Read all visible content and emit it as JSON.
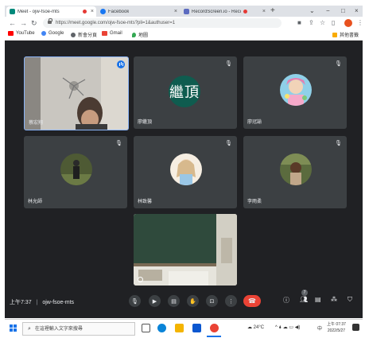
{
  "browser": {
    "tabs": [
      {
        "title": "Meet - ojw-fsoe-mts",
        "active": true,
        "recording": true
      },
      {
        "title": "Facebook",
        "active": false,
        "recording": false
      },
      {
        "title": "RecordScreen.io - Record",
        "active": false,
        "recording": true
      }
    ],
    "new_tab": "+",
    "window": {
      "minimize": "⌄",
      "restore": "−",
      "maximize": "□",
      "close": "×"
    },
    "address": {
      "url": "https://meet.google.com/ojw-fsoe-mts?pli=1&authuser=1"
    },
    "bookmarks": [
      {
        "label": "YouTube",
        "color": "#ff0000"
      },
      {
        "label": "Google",
        "color": "#4285f4"
      },
      {
        "label": "新會分頁",
        "color": "#5f6368"
      },
      {
        "label": "Gmail",
        "color": "#ea4335"
      },
      {
        "label": "地圖",
        "color": "#34a853"
      }
    ],
    "other_bookmarks": "其他書籤"
  },
  "meet": {
    "participants": [
      {
        "name": "蔡宏翔",
        "kind": "video",
        "speaking": true
      },
      {
        "name": "廖繼頂",
        "kind": "letters",
        "letters": "繼頂",
        "muted": true
      },
      {
        "name": "廖冠諭",
        "kind": "photo",
        "muted": true
      },
      {
        "name": "林允師",
        "kind": "photo",
        "muted": true
      },
      {
        "name": "林致馨",
        "kind": "photo",
        "muted": true
      },
      {
        "name": "李雨柔",
        "kind": "photo",
        "muted": true
      }
    ],
    "presentation_tile": "classroom-video",
    "time": "上午7:37",
    "separator": "|",
    "meeting_code": "ojw-fsoe-mts",
    "people_count": "7",
    "colors": {
      "background": "#202124",
      "tile": "#3c4043",
      "end_call": "#ea4335",
      "accent": "#1a73e8"
    }
  },
  "taskbar": {
    "search_placeholder": "在這裡輸入文字來搜尋",
    "weather": "24°C",
    "ime": "中",
    "time": "上午 07:37",
    "date": "2022/5/27"
  }
}
